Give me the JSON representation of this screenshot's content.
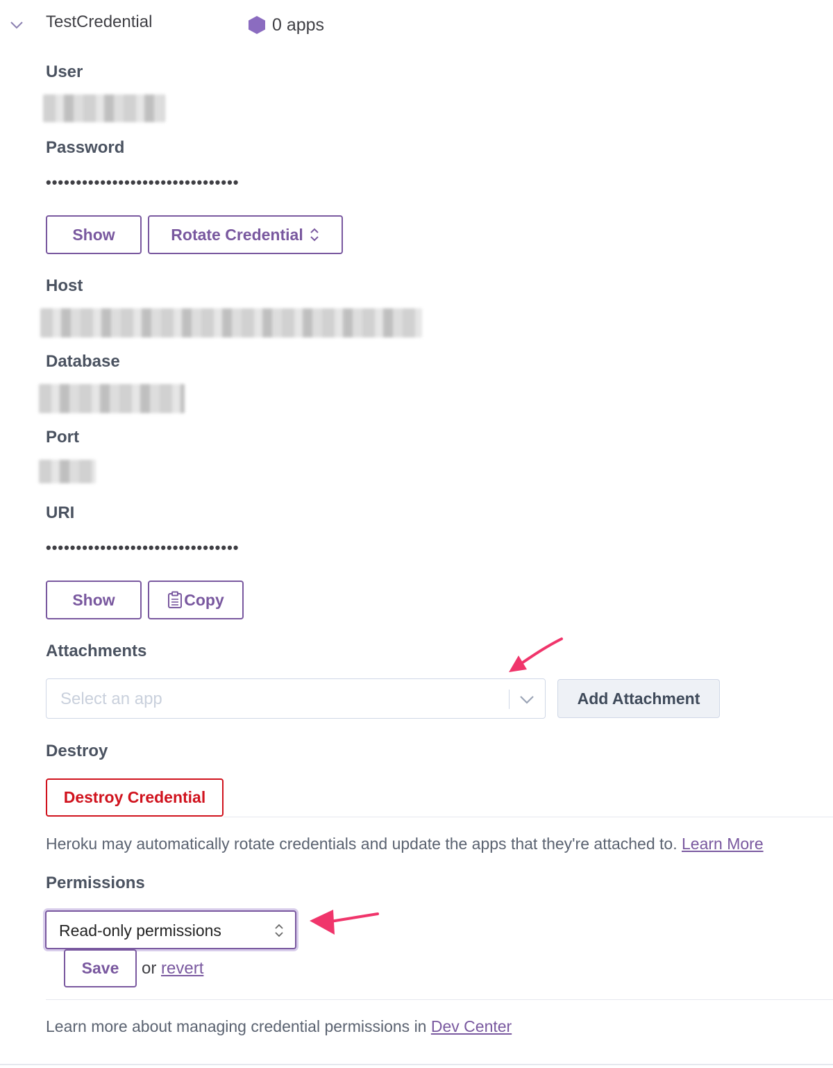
{
  "credential": {
    "name": "TestCredential",
    "apps_count": "0 apps"
  },
  "fields": {
    "user_label": "User",
    "password_label": "Password",
    "password_value": "••••••••••••••••••••••••••••••••",
    "host_label": "Host",
    "database_label": "Database",
    "port_label": "Port",
    "uri_label": "URI",
    "uri_value": "••••••••••••••••••••••••••••••••"
  },
  "buttons": {
    "show_password": "Show",
    "rotate_credential": "Rotate Credential",
    "show_uri": "Show",
    "copy": "Copy"
  },
  "attachments": {
    "label": "Attachments",
    "select_placeholder": "Select an app",
    "add_button": "Add Attachment"
  },
  "destroy": {
    "label": "Destroy",
    "button": "Destroy Credential"
  },
  "rotation_note": {
    "text": "Heroku may automatically rotate credentials and update the apps that they're attached to.",
    "link": "Learn More"
  },
  "permissions": {
    "label": "Permissions",
    "selected": "Read-only permissions",
    "save_button": "Save",
    "or_text": "or",
    "revert_link": "revert"
  },
  "footer_note": {
    "text": "Learn more about managing credential permissions in",
    "link": "Dev Center"
  },
  "colors": {
    "accent": "#79589f",
    "danger": "#d0121d",
    "annotation_arrow": "#f0356b"
  }
}
